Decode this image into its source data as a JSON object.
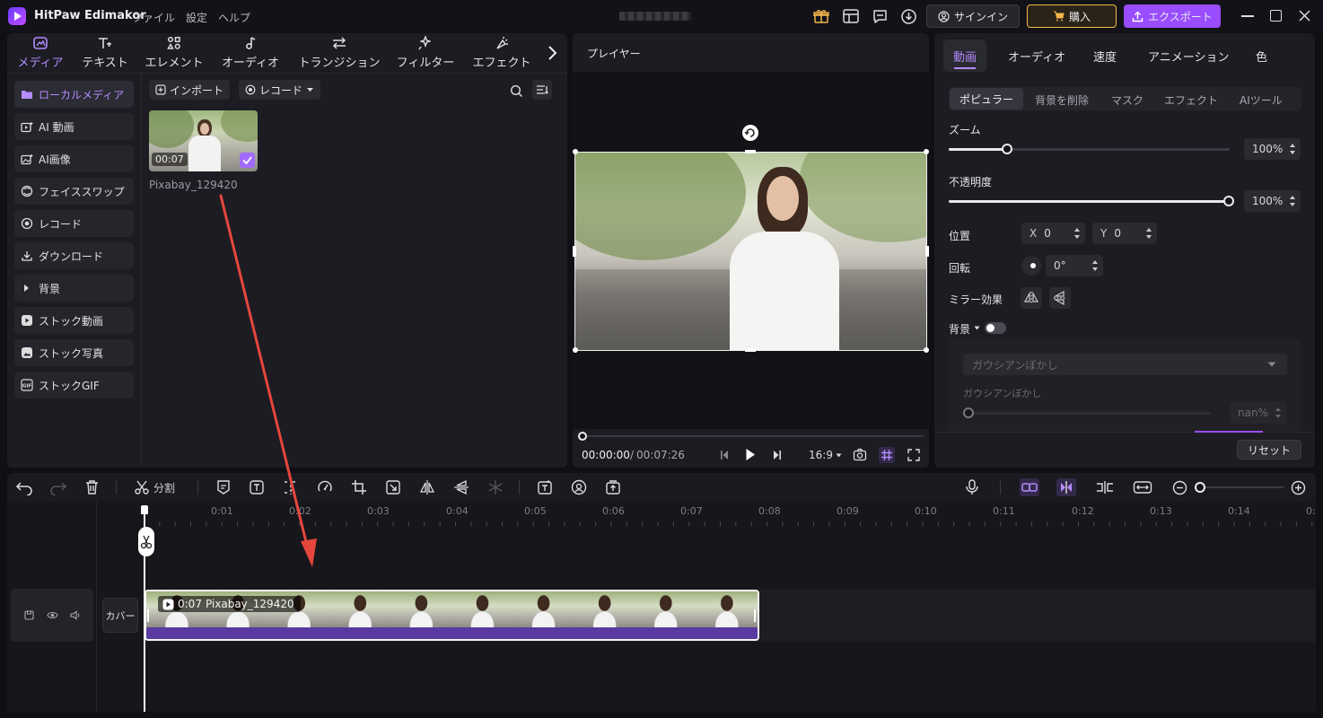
{
  "app": {
    "name": "HitPaw Edimakor",
    "menus": [
      "ファイル",
      "設定",
      "ヘルプ"
    ]
  },
  "header": {
    "signin_label": "サインイン",
    "buy_label": "購入",
    "export_label": "エクスポート"
  },
  "media_tabs": [
    {
      "label": "メディア",
      "icon": "media-icon",
      "active": true
    },
    {
      "label": "テキスト",
      "icon": "text-icon"
    },
    {
      "label": "エレメント",
      "icon": "elements-icon"
    },
    {
      "label": "オーディオ",
      "icon": "audio-icon"
    },
    {
      "label": "トランジション",
      "icon": "transition-icon"
    },
    {
      "label": "フィルター",
      "icon": "filter-icon"
    },
    {
      "label": "エフェクト",
      "icon": "effect-icon"
    }
  ],
  "sidebar": {
    "items": [
      {
        "label": "ローカルメディア",
        "icon": "folder-icon",
        "active": true
      },
      {
        "label": "AI 動画",
        "icon": "ai-video-icon"
      },
      {
        "label": "AI画像",
        "icon": "ai-image-icon"
      },
      {
        "label": "フェイススワップ",
        "icon": "face-swap-icon"
      },
      {
        "label": "レコード",
        "icon": "record-icon"
      },
      {
        "label": "ダウンロード",
        "icon": "download-icon"
      },
      {
        "label": "背景",
        "icon": "caret-right-icon"
      },
      {
        "label": "ストック動画",
        "icon": "stock-video-icon"
      },
      {
        "label": "ストック写真",
        "icon": "stock-photo-icon"
      },
      {
        "label": "ストックGIF",
        "icon": "gif-icon"
      }
    ]
  },
  "media": {
    "import_label": "インポート",
    "record_label": "レコード",
    "clip": {
      "name": "Pixabay_129420",
      "duration": "00:07"
    }
  },
  "player": {
    "title": "プレイヤー",
    "current_time": "00:00:00",
    "separator": "/",
    "total_time": "00:07:26",
    "aspect": "16:9",
    "progress": 0
  },
  "properties": {
    "tabs": [
      {
        "label": "動画",
        "active": true
      },
      {
        "label": "オーディオ"
      },
      {
        "label": "速度"
      },
      {
        "label": "アニメーション"
      },
      {
        "label": "色"
      }
    ],
    "subtabs": [
      {
        "label": "ポピュラー",
        "active": true
      },
      {
        "label": "背景を削除"
      },
      {
        "label": "マスク"
      },
      {
        "label": "エフェクト"
      },
      {
        "label": "AIツール"
      }
    ],
    "zoom": {
      "label": "ズーム",
      "value": "100%",
      "level": 0.12
    },
    "opacity": {
      "label": "不透明度",
      "value": "100%",
      "level": 1.0
    },
    "position": {
      "label": "位置",
      "x_label": "X",
      "x": "0",
      "y_label": "Y",
      "y": "0"
    },
    "rotation": {
      "label": "回転",
      "value": "0°"
    },
    "mirror": {
      "label": "ミラー効果"
    },
    "background": {
      "label": "背景",
      "enabled": false,
      "select_value": "ガウシアンぼかし",
      "blur_label": "ガウシアンぼかし",
      "blur_value": "nan%"
    },
    "reset_label": "リセット"
  },
  "toolbar": {
    "split_label": "分割"
  },
  "timeline": {
    "ruler": [
      "0:01",
      "0:02",
      "0:03",
      "0:04",
      "0:05",
      "0:06",
      "0:07",
      "0:08",
      "0:09",
      "0:10",
      "0:11",
      "0:12",
      "0:13",
      "0:14",
      "0:"
    ],
    "cover_label": "カバー",
    "clip": {
      "duration": "0:07",
      "name": "Pixabay_129420"
    }
  },
  "colors": {
    "accent": "#9a4dff",
    "buy_bg": "#2a2418",
    "buy_border": "#f0b94a",
    "clip_bar": "#5a3aa0"
  }
}
